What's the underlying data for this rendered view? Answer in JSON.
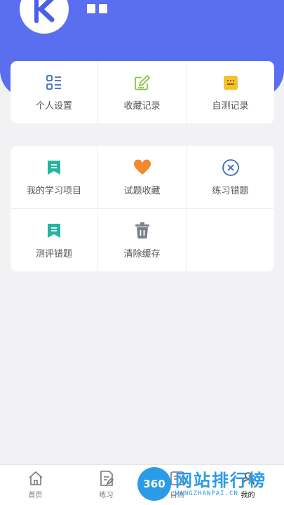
{
  "colors": {
    "header": "#5a6ef0",
    "blue_icon": "#3a6fb0",
    "green_icon": "#8bc34a",
    "yellow_icon": "#f6c02c",
    "teal_icon": "#26b5a0",
    "orange_icon": "#f28a2c",
    "gray_icon": "#7a7f88",
    "watermark": "#2b9be8"
  },
  "profile": {
    "avatar_icon": "app-logo-k-icon",
    "name_icon": "redacted-name-blocks"
  },
  "quick_menu": [
    {
      "label": "个人设置",
      "icon": "list-settings-icon"
    },
    {
      "label": "收藏记录",
      "icon": "edit-note-icon"
    },
    {
      "label": "自测记录",
      "icon": "record-icon"
    }
  ],
  "study_menu": [
    {
      "label": "我的学习项目",
      "icon": "bookmark-icon"
    },
    {
      "label": "试题收藏",
      "icon": "heart-icon"
    },
    {
      "label": "练习错题",
      "icon": "close-circle-icon"
    },
    {
      "label": "测评错题",
      "icon": "bookmark-icon"
    },
    {
      "label": "清除缓存",
      "icon": "trash-icon"
    }
  ],
  "tabbar": [
    {
      "label": "首页",
      "icon": "home-icon"
    },
    {
      "label": "练习",
      "icon": "practice-icon"
    },
    {
      "label": "自测",
      "icon": "self-test-icon"
    },
    {
      "label": "我的",
      "icon": "profile-icon",
      "active": true
    }
  ],
  "watermark": {
    "logo": "360",
    "title": "网站排行榜",
    "subtitle": "WANGZHANPAI.CN"
  }
}
